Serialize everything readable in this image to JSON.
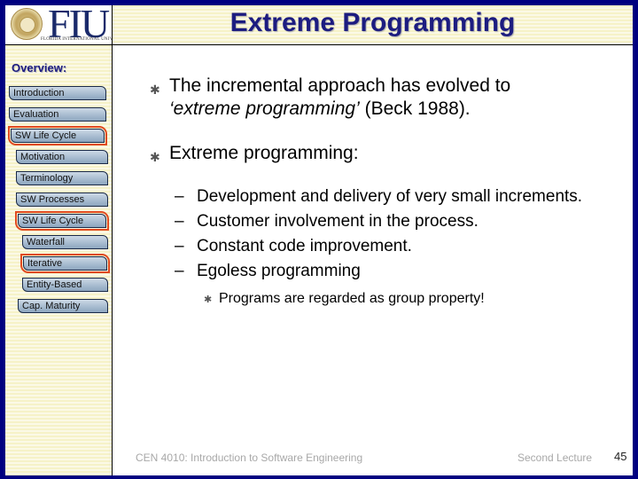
{
  "header": {
    "logo_text": "FIU",
    "logo_subtext": "FLORIDA INTERNATIONAL UNIVERSITY",
    "title": "Extreme Programming"
  },
  "sidebar": {
    "heading": "Overview:",
    "items": [
      {
        "label": "Introduction",
        "active": false
      },
      {
        "label": "Evaluation",
        "active": false
      },
      {
        "label": "SW Life Cycle",
        "active": true
      },
      {
        "label": "Motivation",
        "active": false
      },
      {
        "label": "Terminology",
        "active": false
      },
      {
        "label": "SW Processes",
        "active": false
      },
      {
        "label": "SW Life Cycle",
        "active": true
      },
      {
        "label": "Waterfall",
        "active": false
      },
      {
        "label": "Iterative",
        "active": true
      },
      {
        "label": "Entity-Based",
        "active": false
      },
      {
        "label": "Cap. Maturity",
        "active": false
      }
    ]
  },
  "content": {
    "bullet1": {
      "line1": "The incremental approach has evolved to",
      "italic": "‘extreme programming’",
      "rest": " (Beck 1988)."
    },
    "bullet2": {
      "text": "Extreme programming:",
      "subitems": [
        "Development and delivery of very small increments.",
        "Customer involvement in the process.",
        "Constant code improvement.",
        "Egoless programming"
      ],
      "subsub": "Programs are regarded as group property!"
    },
    "bullet_glyph": "✱",
    "dash_glyph": "–"
  },
  "footer": {
    "course": "CEN 4010: Introduction to Software Engineering",
    "lecture": "Second Lecture",
    "page_number": "45"
  },
  "colors": {
    "frame": "#000080",
    "title": "#1c1c80",
    "active_outline": "#e04a20"
  }
}
